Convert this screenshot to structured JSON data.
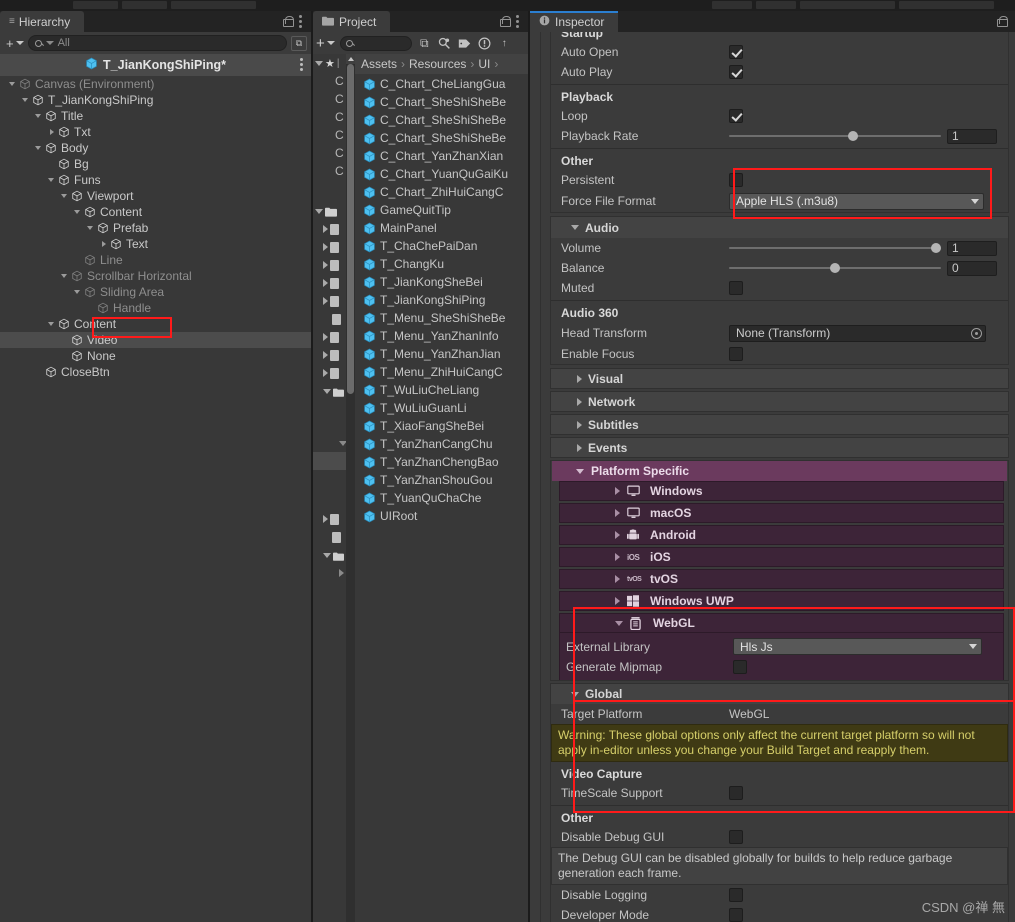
{
  "window": {
    "hierarchy_tab": "Hierarchy",
    "project_tab": "Project",
    "inspector_tab": "Inspector",
    "watermark": "CSDN @禅 無"
  },
  "hierarchy": {
    "search_placeholder": "All",
    "scene_root": "T_JianKongShiPing*",
    "tree": [
      {
        "label": "Canvas (Environment)",
        "depth": 1,
        "twist": "open",
        "dim": true
      },
      {
        "label": "T_JianKongShiPing",
        "depth": 2,
        "twist": "open",
        "dim": false
      },
      {
        "label": "Title",
        "depth": 3,
        "twist": "open",
        "dim": false
      },
      {
        "label": "Txt",
        "depth": 4,
        "twist": "closed",
        "dim": false
      },
      {
        "label": "Body",
        "depth": 3,
        "twist": "open",
        "dim": false
      },
      {
        "label": "Bg",
        "depth": 4,
        "twist": "none",
        "dim": false
      },
      {
        "label": "Funs",
        "depth": 4,
        "twist": "open",
        "dim": false
      },
      {
        "label": "Viewport",
        "depth": 5,
        "twist": "open",
        "dim": false
      },
      {
        "label": "Content",
        "depth": 6,
        "twist": "open",
        "dim": false
      },
      {
        "label": "Prefab",
        "depth": 7,
        "twist": "open",
        "dim": false
      },
      {
        "label": "Text",
        "depth": 8,
        "twist": "closed",
        "dim": false
      },
      {
        "label": "Line",
        "depth": 6,
        "twist": "none",
        "dim": true
      },
      {
        "label": "Scrollbar Horizontal",
        "depth": 5,
        "twist": "open",
        "dim": true
      },
      {
        "label": "Sliding Area",
        "depth": 6,
        "twist": "open",
        "dim": true
      },
      {
        "label": "Handle",
        "depth": 7,
        "twist": "none",
        "dim": true
      },
      {
        "label": "Content",
        "depth": 4,
        "twist": "open",
        "dim": false
      },
      {
        "label": "Video",
        "depth": 5,
        "twist": "none",
        "dim": false,
        "selected": true
      },
      {
        "label": "None",
        "depth": 5,
        "twist": "none",
        "dim": false
      },
      {
        "label": "CloseBtn",
        "depth": 3,
        "twist": "none",
        "dim": false
      }
    ]
  },
  "project": {
    "search_value": "",
    "breadcrumb": [
      "Assets",
      "Resources",
      "UI"
    ],
    "assets": [
      "C_Chart_CheLiangGua",
      "C_Chart_SheShiSheBe",
      "C_Chart_SheShiSheBe",
      "C_Chart_SheShiSheBe",
      "C_Chart_YanZhanXian",
      "C_Chart_YuanQuGaiKu",
      "C_Chart_ZhiHuiCangC",
      "GameQuitTip",
      "MainPanel",
      "T_ChaChePaiDan",
      "T_ChangKu",
      "T_JianKongSheBei",
      "T_JianKongShiPing",
      "T_Menu_SheShiSheBe",
      "T_Menu_YanZhanInfo",
      "T_Menu_YanZhanJian",
      "T_Menu_ZhiHuiCangC",
      "T_WuLiuCheLiang",
      "T_WuLiuGuanLi",
      "T_XiaoFangSheBei",
      "T_YanZhanCangChu",
      "T_YanZhanChengBao",
      "T_YanZhanShouGou",
      "T_YuanQuChaChe",
      "UIRoot"
    ]
  },
  "inspector": {
    "sections": {
      "startup": {
        "title": "Startup",
        "auto_open_label": "Auto Open",
        "auto_open_checked": true,
        "auto_play_label": "Auto Play",
        "auto_play_checked": true
      },
      "playback": {
        "title": "Playback",
        "loop_label": "Loop",
        "loop_checked": true,
        "rate_label": "Playback Rate",
        "rate_value": "1",
        "rate_fraction": 0.56
      },
      "other": {
        "title": "Other",
        "persistent_label": "Persistent",
        "persistent_checked": false,
        "force_format_label": "Force File Format",
        "force_format_value": "Apple HLS (.m3u8)"
      },
      "audio": {
        "title": "Audio",
        "volume_label": "Volume",
        "volume_value": "1",
        "volume_fraction": 1.0,
        "balance_label": "Balance",
        "balance_value": "0",
        "balance_fraction": 0.5,
        "muted_label": "Muted",
        "muted_checked": false
      },
      "audio360": {
        "title": "Audio 360",
        "head_transform_label": "Head Transform",
        "head_transform_value": "None (Transform)",
        "enable_focus_label": "Enable Focus",
        "enable_focus_checked": false
      },
      "collapsed_foldouts": [
        {
          "label": "Visual"
        },
        {
          "label": "Network"
        },
        {
          "label": "Subtitles"
        },
        {
          "label": "Events"
        }
      ],
      "platform_specific": {
        "title": "Platform Specific",
        "platforms": [
          {
            "label": "Windows",
            "icon": "monitor-icon",
            "expanded": false
          },
          {
            "label": "macOS",
            "icon": "monitor-icon",
            "expanded": false
          },
          {
            "label": "Android",
            "icon": "android-icon",
            "expanded": false
          },
          {
            "label": "iOS",
            "icon": "ios-icon",
            "expanded": false
          },
          {
            "label": "tvOS",
            "icon": "tvos-icon",
            "expanded": false
          },
          {
            "label": "Windows UWP",
            "icon": "windows-icon",
            "expanded": false
          },
          {
            "label": "WebGL",
            "icon": "webgl-icon",
            "expanded": true
          }
        ],
        "webgl": {
          "external_library_label": "External Library",
          "external_library_value": "Hls Js",
          "generate_mipmap_label": "Generate Mipmap",
          "generate_mipmap_checked": false
        }
      },
      "global": {
        "title": "Global",
        "target_platform_label": "Target Platform",
        "target_platform_value": "WebGL",
        "warning_text": "Warning: These global options only affect the current target platform so will not apply in-editor unless you change your Build Target and reapply them.",
        "video_capture_title": "Video Capture",
        "timescale_label": "TimeScale Support",
        "timescale_checked": false,
        "other_title": "Other",
        "disable_debug_gui_label": "Disable Debug GUI",
        "disable_debug_gui_checked": false,
        "debug_gui_help": "The Debug GUI can be disabled globally for builds to help reduce garbage generation each frame.",
        "disable_logging_label": "Disable Logging",
        "disable_logging_checked": false,
        "developer_mode_label": "Developer Mode",
        "developer_mode_checked": false
      }
    }
  },
  "colors": {
    "accent_tab": "#2b7fd1",
    "highlight_box": "#ff1a1a",
    "platform_header": "#6b3a5e",
    "platform_row": "#3d2438",
    "warning_bg": "#3f3a14",
    "warning_text": "#d6cf6a"
  }
}
